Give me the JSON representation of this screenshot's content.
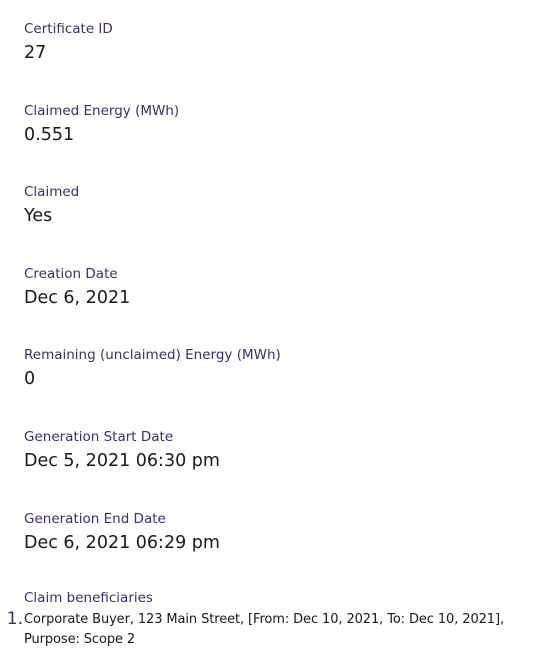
{
  "fields": [
    {
      "label": "Certificate ID",
      "value": "27"
    },
    {
      "label": "Claimed Energy (MWh)",
      "value": "0.551"
    },
    {
      "label": "Claimed",
      "value": "Yes"
    },
    {
      "label": "Creation Date",
      "value": "Dec 6, 2021"
    },
    {
      "label": "Remaining (unclaimed) Energy (MWh)",
      "value": "0"
    },
    {
      "label": "Generation Start Date",
      "value": "Dec 5, 2021 06:30 pm"
    },
    {
      "label": "Generation End Date",
      "value": "Dec 6, 2021 06:29 pm"
    }
  ],
  "beneficiaries": {
    "label": "Claim beneficiaries",
    "items": [
      {
        "marker": "1.",
        "text": "Corporate Buyer, 123 Main Street, [From: Dec 10, 2021, To: Dec 10, 2021], Purpose: Scope 2"
      }
    ]
  }
}
